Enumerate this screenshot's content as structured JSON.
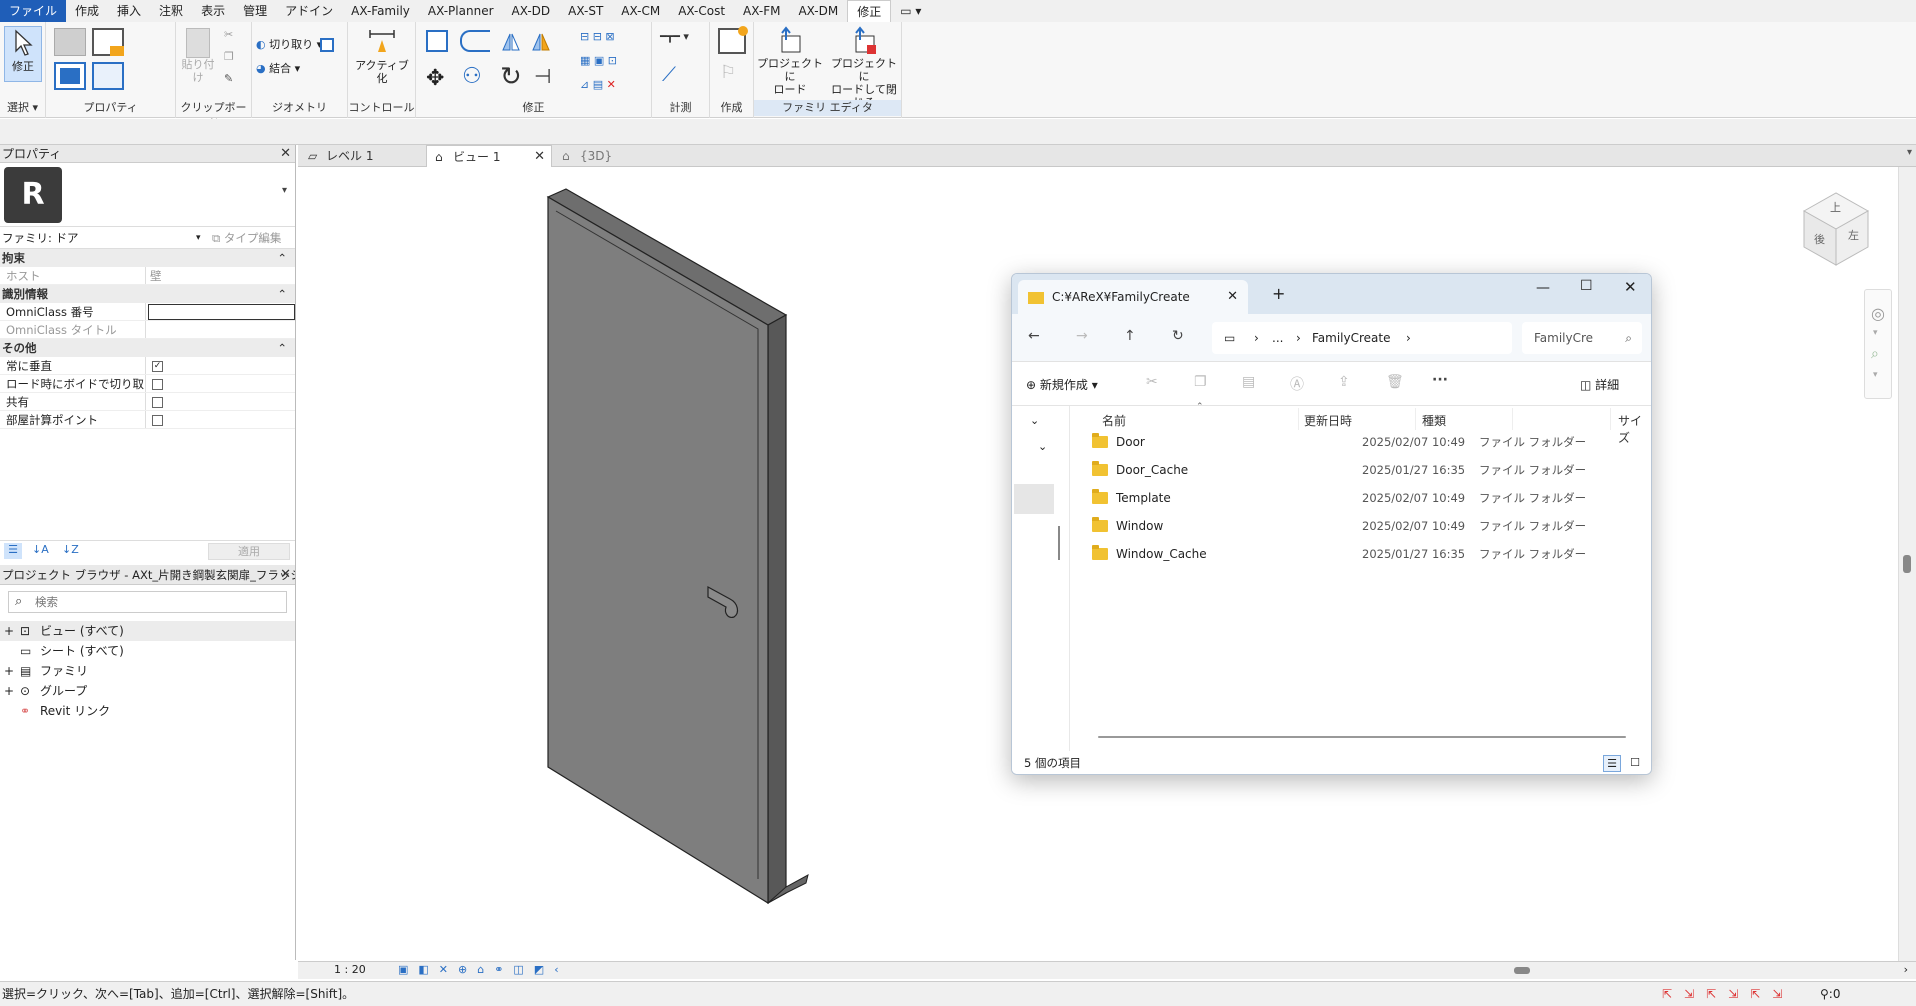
{
  "menu": {
    "tabs": [
      "ファイル",
      "作成",
      "挿入",
      "注釈",
      "表示",
      "管理",
      "アドイン",
      "AX-Family",
      "AX-Planner",
      "AX-DD",
      "AX-ST",
      "AX-CM",
      "AX-Cost",
      "AX-FM",
      "AX-DM",
      "修正"
    ],
    "active": "修正"
  },
  "ribbon": {
    "groups": {
      "select": "選択",
      "properties": "プロパティ",
      "clipboard": "クリップボード",
      "geometry": "ジオメトリ",
      "control": "コントロール",
      "modify": "修正",
      "measure": "計測",
      "create": "作成",
      "family_editor": "ファミリ エディタ"
    },
    "modify_button": "修正",
    "paste_label": "貼り付け",
    "cut_label": "切り取り",
    "join_label": "結合",
    "activate_label": "アクティブ化",
    "load_project_label_1": "プロジェクトに",
    "load_project_label_2": "ロード",
    "load_close_label_1": "プロジェクトに",
    "load_close_label_2": "ロードして閉じる"
  },
  "properties": {
    "title": "プロパティ",
    "family_type": "ファミリ: ドア",
    "edit_type": "タイプ編集",
    "categories": {
      "constraints": "拘束",
      "identity": "識別情報",
      "other": "その他"
    },
    "rows": {
      "host": {
        "label": "ホスト",
        "value": "壁"
      },
      "omniclass_number": {
        "label": "OmniClass 番号",
        "value": ""
      },
      "omniclass_title": {
        "label": "OmniClass タイトル",
        "value": ""
      },
      "always_vertical": {
        "label": "常に垂直",
        "checked": true
      },
      "cut_voids": {
        "label": "ロード時にボイドで切り取り",
        "checked": false
      },
      "shared": {
        "label": "共有",
        "checked": false
      },
      "room_point": {
        "label": "部屋計算ポイント",
        "checked": false
      }
    },
    "apply": "適用"
  },
  "browser": {
    "title": "プロジェクト ブラウザ - AXt_片開き鋼製玄関扉_フラッシュ...",
    "search_placeholder": "検索",
    "items": [
      "ビュー (すべて)",
      "シート (すべて)",
      "ファミリ",
      "グループ",
      "Revit リンク"
    ]
  },
  "view_tabs": [
    "レベル 1",
    "ビュー 1",
    "{3D}"
  ],
  "view_scale": "1 : 20",
  "status_text": "選択=クリック、次へ=[Tab]、追加=[Ctrl]、選択解除=[Shift]。",
  "filter_count": ":0",
  "viewcube": {
    "top": "上",
    "front": "後",
    "left": "左"
  },
  "explorer": {
    "tab_title": "C:¥AReX¥FamilyCreate",
    "breadcrumb_more": "...",
    "breadcrumb_current": "FamilyCreate",
    "search_text": "FamilyCre",
    "new_label": "新規作成",
    "details_label": "詳細",
    "columns": {
      "name": "名前",
      "date": "更新日時",
      "type": "種類",
      "size": "サイズ"
    },
    "rows": [
      {
        "name": "Door",
        "date": "2025/02/07 10:49",
        "type": "ファイル フォルダー"
      },
      {
        "name": "Door_Cache",
        "date": "2025/01/27 16:35",
        "type": "ファイル フォルダー"
      },
      {
        "name": "Template",
        "date": "2025/02/07 10:49",
        "type": "ファイル フォルダー"
      },
      {
        "name": "Window",
        "date": "2025/02/07 10:49",
        "type": "ファイル フォルダー"
      },
      {
        "name": "Window_Cache",
        "date": "2025/01/27 16:35",
        "type": "ファイル フォルダー"
      }
    ],
    "item_count": "5 個の項目"
  }
}
